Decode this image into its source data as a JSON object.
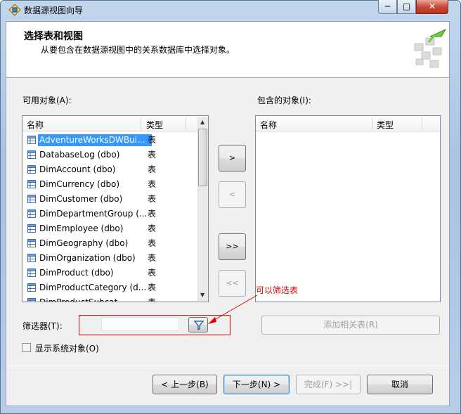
{
  "window": {
    "title": "数据源视图向导"
  },
  "header": {
    "title": "选择表和视图",
    "subtitle": "从要包含在数据源视图中的关系数据库中选择对象。"
  },
  "available": {
    "label": "可用对象(A):",
    "col_name": "名称",
    "col_type": "类型",
    "items": [
      {
        "name": "AdventureWorksDWBui...",
        "type": "表"
      },
      {
        "name": "DatabaseLog (dbo)",
        "type": "表"
      },
      {
        "name": "DimAccount (dbo)",
        "type": "表"
      },
      {
        "name": "DimCurrency (dbo)",
        "type": "表"
      },
      {
        "name": "DimCustomer (dbo)",
        "type": "表"
      },
      {
        "name": "DimDepartmentGroup (...",
        "type": "表"
      },
      {
        "name": "DimEmployee (dbo)",
        "type": "表"
      },
      {
        "name": "DimGeography (dbo)",
        "type": "表"
      },
      {
        "name": "DimOrganization (dbo)",
        "type": "表"
      },
      {
        "name": "DimProduct (dbo)",
        "type": "表"
      },
      {
        "name": "DimProductCategory (d...",
        "type": "表"
      },
      {
        "name": "DimProductSubcat...",
        "type": "表"
      }
    ]
  },
  "included": {
    "label": "包含的对象(I):",
    "col_name": "名称",
    "col_type": "类型"
  },
  "move": {
    "add_one": ">",
    "remove_one": "<",
    "add_all": ">>",
    "remove_all": "<<"
  },
  "filter": {
    "label": "筛选器(T):",
    "value": "",
    "annotation": "可以筛选表"
  },
  "add_related": "添加相关表(R)",
  "show_system": "显示系统对象(O)",
  "footer": {
    "back": "< 上一步(B)",
    "next": "下一步(N) >",
    "finish": "完成(F) >>|",
    "cancel": "取消"
  },
  "colors": {
    "selection": "#3399ff",
    "annotation": "#e00000",
    "frame": "#b8cde8"
  },
  "icons": [
    "app-icon",
    "minimize-icon",
    "maximize-icon",
    "close-icon",
    "table-icon",
    "filter-funnel-icon",
    "wizard-art-icon"
  ]
}
